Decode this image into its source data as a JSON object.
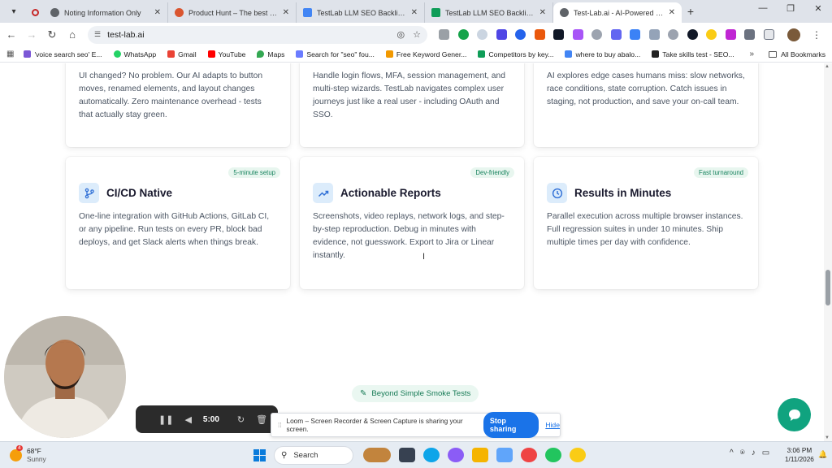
{
  "browser": {
    "tabs": [
      {
        "label": "Noting Information Only",
        "favicon_color": "#5f6368"
      },
      {
        "label": "Product Hunt – The best new p",
        "favicon_color": "#da552f"
      },
      {
        "label": "TestLab LLM SEO Backlink Deta",
        "favicon_color": "#4285f4"
      },
      {
        "label": "TestLab LLM SEO Backlink - Go",
        "favicon_color": "#0f9d58"
      },
      {
        "label": "Test-Lab.ai - AI-Powered Qualit",
        "favicon_color": "#5f6368"
      }
    ],
    "active_tab_index": 4,
    "address": "test-lab.ai",
    "bookmarks": [
      {
        "label": "'voice search seo' E...",
        "color": "#7b57d6"
      },
      {
        "label": "WhatsApp",
        "color": "#25d366"
      },
      {
        "label": "Gmail",
        "color": "#ea4335"
      },
      {
        "label": "YouTube",
        "color": "#ff0000"
      },
      {
        "label": "Maps",
        "color": "#34a853"
      },
      {
        "label": "Search for \"seo\" fou...",
        "color": "#6b7cff"
      },
      {
        "label": "Free Keyword Gener...",
        "color": "#f29900"
      },
      {
        "label": "Competitors by key...",
        "color": "#0f9d58"
      },
      {
        "label": "where to buy abalo...",
        "color": "#4285f4"
      },
      {
        "label": "Take skills test - SEO...",
        "color": "#222222"
      }
    ],
    "all_bookmarks_label": "All Bookmarks"
  },
  "page": {
    "top_cards": [
      {
        "text": "UI changed? No problem. Our AI adapts to button moves, renamed elements, and layout changes automatically. Zero maintenance overhead - tests that actually stay green."
      },
      {
        "text": "Handle login flows, MFA, session management, and multi-step wizards. TestLab navigates complex user journeys just like a real user - including OAuth and SSO."
      },
      {
        "text": "AI explores edge cases humans miss: slow networks, race conditions, state corruption. Catch issues in staging, not production, and save your on-call team."
      }
    ],
    "feature_cards": [
      {
        "badge": "5-minute setup",
        "title": "CI/CD Native",
        "icon": "git-branch-icon",
        "text": "One-line integration with GitHub Actions, GitLab CI, or any pipeline. Run tests on every PR, block bad deploys, and get Slack alerts when things break."
      },
      {
        "badge": "Dev-friendly",
        "title": "Actionable Reports",
        "icon": "trending-up-icon",
        "text": "Screenshots, video replays, network logs, and step-by-step reproduction. Debug in minutes with evidence, not guesswork. Export to Jira or Linear instantly."
      },
      {
        "badge": "Fast turnaround",
        "title": "Results in Minutes",
        "icon": "clock-icon",
        "text": "Parallel execution across multiple browser instances. Full regression suites in under 10 minutes. Ship multiple times per day with confidence."
      }
    ],
    "section_pill": "Beyond Simple Smoke Tests"
  },
  "loom": {
    "timer": "5:00",
    "share_message": "Loom – Screen Recorder & Screen Capture is sharing your screen.",
    "stop_sharing_label": "Stop sharing",
    "hide_label": "Hide"
  },
  "taskbar": {
    "weather_badge": "4",
    "temperature": "68°F",
    "condition": "Sunny",
    "search_label": "Search",
    "time": "3:06 PM",
    "date": "1/11/2026"
  },
  "colors": {
    "accent_green": "#10a37f",
    "badge_green_text": "#16825d",
    "icon_box": "#dcecfb",
    "stop_sharing_blue": "#1a73e8"
  }
}
